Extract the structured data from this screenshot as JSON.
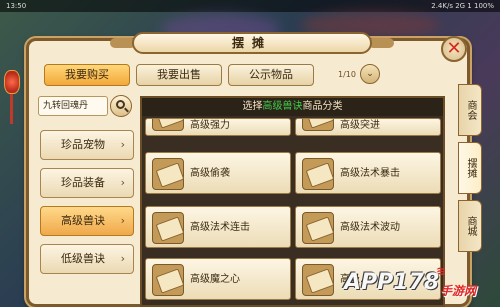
{
  "status": {
    "time": "13:50",
    "right": "2.4K/s  2G  1 100%"
  },
  "dialog": {
    "title": "摆摊",
    "close_glyph": "✕"
  },
  "tabs": [
    {
      "label": "我要购买",
      "active": true
    },
    {
      "label": "我要出售",
      "active": false
    },
    {
      "label": "公示物品",
      "active": false
    }
  ],
  "page": {
    "indicator": "1/10",
    "toggle_glyph": "⌄"
  },
  "search": {
    "value": "九转回魂丹"
  },
  "categories": [
    {
      "label": "珍品宠物",
      "active": false
    },
    {
      "label": "珍品装备",
      "active": false
    },
    {
      "label": "高级兽诀",
      "active": true
    },
    {
      "label": "低级兽诀",
      "active": false
    }
  ],
  "category_chevron": "›",
  "grid": {
    "header_prefix": "选择",
    "header_highlight": "高级兽诀",
    "header_suffix": "商品分类",
    "items": [
      {
        "label": "高级强力"
      },
      {
        "label": "高级突进"
      },
      {
        "label": "高级偷袭"
      },
      {
        "label": "高级法术暴击"
      },
      {
        "label": "高级法术连击"
      },
      {
        "label": "高级法术波动"
      },
      {
        "label": "高级魔之心"
      },
      {
        "label": "高级..."
      }
    ]
  },
  "side_tabs": [
    {
      "label": "商会",
      "active": false
    },
    {
      "label": "摆摊",
      "active": true
    },
    {
      "label": "商城",
      "active": false
    }
  ],
  "watermark": {
    "main": "APP178",
    "sub": "手游网"
  },
  "colors": {
    "accent": "#f0a84a",
    "highlight": "#3fcf4a",
    "close": "#d62a1a"
  }
}
